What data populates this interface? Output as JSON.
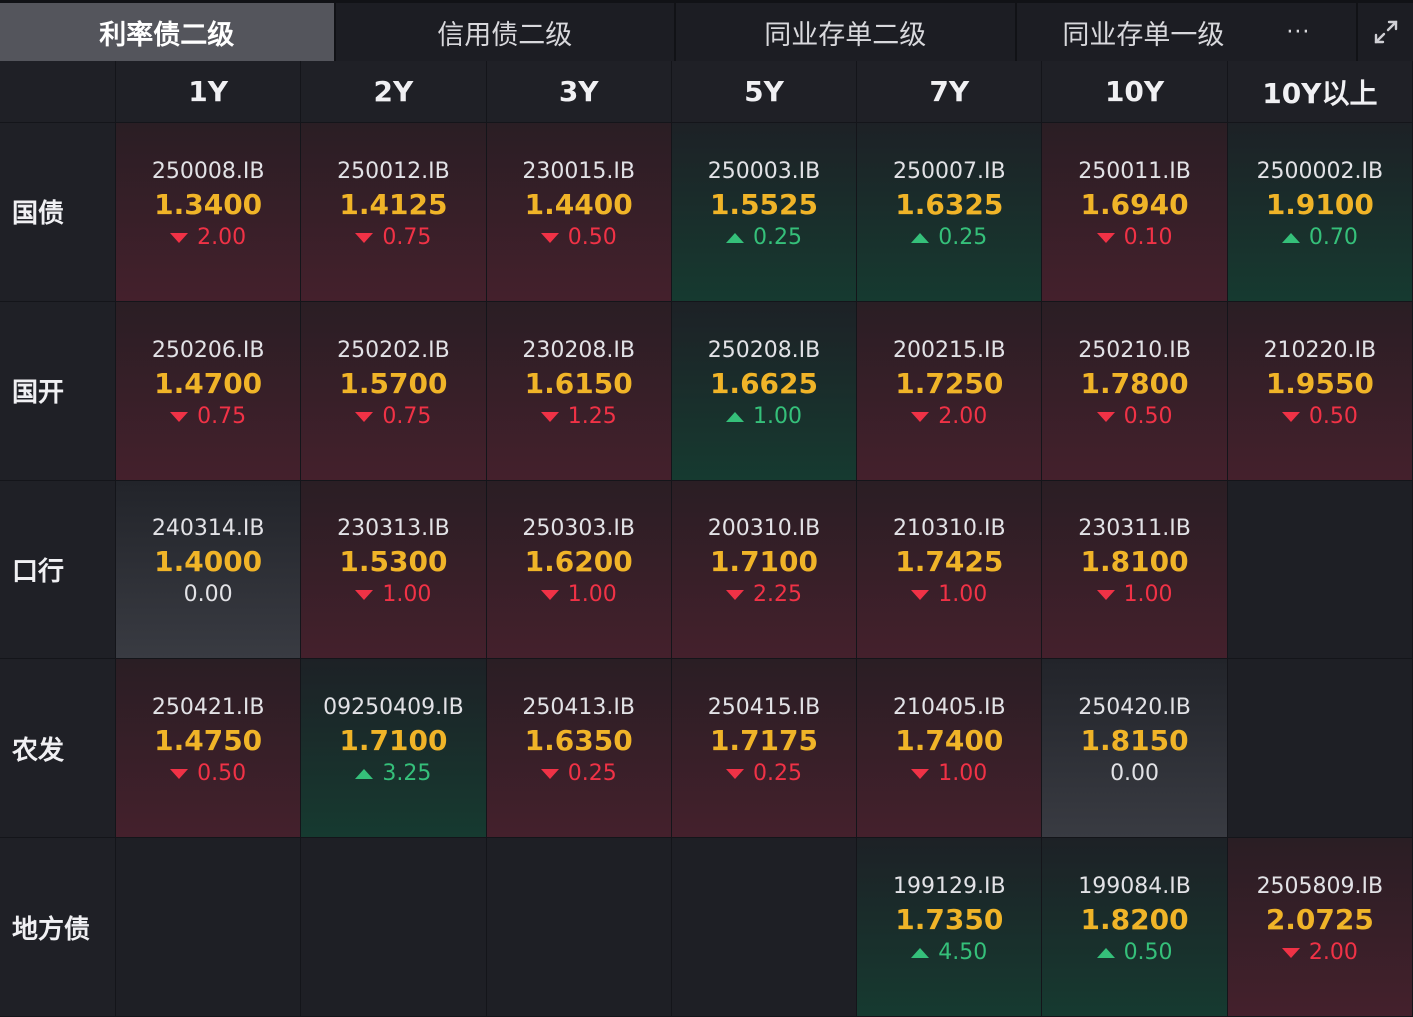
{
  "tabs": [
    {
      "label": "利率债二级",
      "active": true
    },
    {
      "label": "信用债二级",
      "active": false
    },
    {
      "label": "同业存单二级",
      "active": false
    },
    {
      "label": "同业存单一级",
      "active": false
    }
  ],
  "more_label": "···",
  "columns": [
    "1Y",
    "2Y",
    "3Y",
    "5Y",
    "7Y",
    "10Y",
    "10Y以上"
  ],
  "colors": {
    "up": "#35c07a",
    "down": "#f03246",
    "rate": "#f0b428"
  },
  "rows": [
    {
      "label": "国债",
      "cells": [
        {
          "code": "250008.IB",
          "rate": "1.3400",
          "change": "2.00",
          "dir": "down"
        },
        {
          "code": "250012.IB",
          "rate": "1.4125",
          "change": "0.75",
          "dir": "down"
        },
        {
          "code": "230015.IB",
          "rate": "1.4400",
          "change": "0.50",
          "dir": "down"
        },
        {
          "code": "250003.IB",
          "rate": "1.5525",
          "change": "0.25",
          "dir": "up"
        },
        {
          "code": "250007.IB",
          "rate": "1.6325",
          "change": "0.25",
          "dir": "up"
        },
        {
          "code": "250011.IB",
          "rate": "1.6940",
          "change": "0.10",
          "dir": "down"
        },
        {
          "code": "2500002.IB",
          "rate": "1.9100",
          "change": "0.70",
          "dir": "up"
        }
      ]
    },
    {
      "label": "国开",
      "cells": [
        {
          "code": "250206.IB",
          "rate": "1.4700",
          "change": "0.75",
          "dir": "down"
        },
        {
          "code": "250202.IB",
          "rate": "1.5700",
          "change": "0.75",
          "dir": "down"
        },
        {
          "code": "230208.IB",
          "rate": "1.6150",
          "change": "1.25",
          "dir": "down"
        },
        {
          "code": "250208.IB",
          "rate": "1.6625",
          "change": "1.00",
          "dir": "up"
        },
        {
          "code": "200215.IB",
          "rate": "1.7250",
          "change": "2.00",
          "dir": "down"
        },
        {
          "code": "250210.IB",
          "rate": "1.7800",
          "change": "0.50",
          "dir": "down"
        },
        {
          "code": "210220.IB",
          "rate": "1.9550",
          "change": "0.50",
          "dir": "down"
        }
      ]
    },
    {
      "label": "口行",
      "cells": [
        {
          "code": "240314.IB",
          "rate": "1.4000",
          "change": "0.00",
          "dir": "flat"
        },
        {
          "code": "230313.IB",
          "rate": "1.5300",
          "change": "1.00",
          "dir": "down"
        },
        {
          "code": "250303.IB",
          "rate": "1.6200",
          "change": "1.00",
          "dir": "down"
        },
        {
          "code": "200310.IB",
          "rate": "1.7100",
          "change": "2.25",
          "dir": "down"
        },
        {
          "code": "210310.IB",
          "rate": "1.7425",
          "change": "1.00",
          "dir": "down"
        },
        {
          "code": "230311.IB",
          "rate": "1.8100",
          "change": "1.00",
          "dir": "down"
        },
        null
      ]
    },
    {
      "label": "农发",
      "cells": [
        {
          "code": "250421.IB",
          "rate": "1.4750",
          "change": "0.50",
          "dir": "down"
        },
        {
          "code": "09250409.IB",
          "rate": "1.7100",
          "change": "3.25",
          "dir": "up"
        },
        {
          "code": "250413.IB",
          "rate": "1.6350",
          "change": "0.25",
          "dir": "down"
        },
        {
          "code": "250415.IB",
          "rate": "1.7175",
          "change": "0.25",
          "dir": "down"
        },
        {
          "code": "210405.IB",
          "rate": "1.7400",
          "change": "1.00",
          "dir": "down"
        },
        {
          "code": "250420.IB",
          "rate": "1.8150",
          "change": "0.00",
          "dir": "flat"
        },
        null
      ]
    },
    {
      "label": "地方债",
      "cells": [
        null,
        null,
        null,
        null,
        {
          "code": "199129.IB",
          "rate": "1.7350",
          "change": "4.50",
          "dir": "up"
        },
        {
          "code": "199084.IB",
          "rate": "1.8200",
          "change": "0.50",
          "dir": "up"
        },
        {
          "code": "2505809.IB",
          "rate": "2.0725",
          "change": "2.00",
          "dir": "down"
        }
      ]
    }
  ]
}
